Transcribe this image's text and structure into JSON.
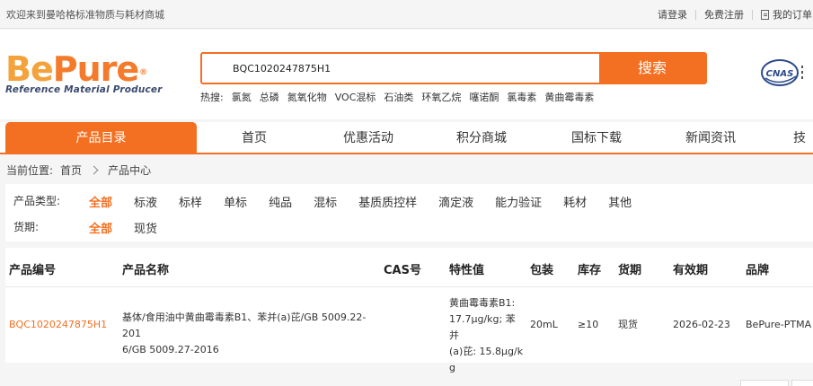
{
  "topbar": {
    "welcome": "欢迎来到曼哈格标准物质与耗材商城",
    "login": "请登录",
    "register": "免费注册",
    "orders": "我的订单"
  },
  "logo": {
    "brand_be": "Be",
    "brand_pure": "Pure",
    "tagline": "Reference Material Producer"
  },
  "search": {
    "value": "BQC1020247875H1",
    "button": "搜索"
  },
  "hot": {
    "label": "热搜:",
    "items": [
      "氯氮",
      "总磷",
      "氮氧化物",
      "VOC混标",
      "石油类",
      "环氧乙烷",
      "噻诺酮",
      "氯毒素",
      "黄曲霉毒素"
    ]
  },
  "cert_badge": "CNAS",
  "nav": {
    "catalog": "产品目录",
    "items": [
      "首页",
      "优惠活动",
      "积分商城",
      "国标下载",
      "新闻资讯",
      "技"
    ]
  },
  "breadcrumb": {
    "label": "当前位置:",
    "home": "首页",
    "current": "产品中心"
  },
  "filters": {
    "type_label": "产品类型:",
    "type_options": [
      "全部",
      "标液",
      "标样",
      "单标",
      "纯品",
      "混标",
      "基质质控样",
      "滴定液",
      "能力验证",
      "耗材",
      "其他"
    ],
    "stock_label": "货期:",
    "stock_options": [
      "全部",
      "现货"
    ]
  },
  "table": {
    "headers": [
      "产品编号",
      "产品名称",
      "CAS号",
      "特性值",
      "包装",
      "库存",
      "货期",
      "有效期",
      "品牌"
    ],
    "row": {
      "code": "BQC1020247875H1",
      "name_line1": "基体/食用油中黄曲霉毒素B1、苯并(a)芘/GB 5009.22-201",
      "name_line2": "6/GB 5009.27-2016",
      "cas": "",
      "prop_line1": "黄曲霉毒素B1:",
      "prop_line2": "17.7μg/kg; 苯并",
      "prop_line3": "(a)芘: 15.8μg/k",
      "prop_line4": "g",
      "pack": "20mL",
      "stock": "≥10",
      "lead": "现货",
      "expiry": "2026-02-23",
      "brand": "BePure-PTMA"
    }
  },
  "colors": {
    "accent": "#f36f21",
    "logo_light": "#f3a23c",
    "tagline": "#3a4b6e"
  }
}
